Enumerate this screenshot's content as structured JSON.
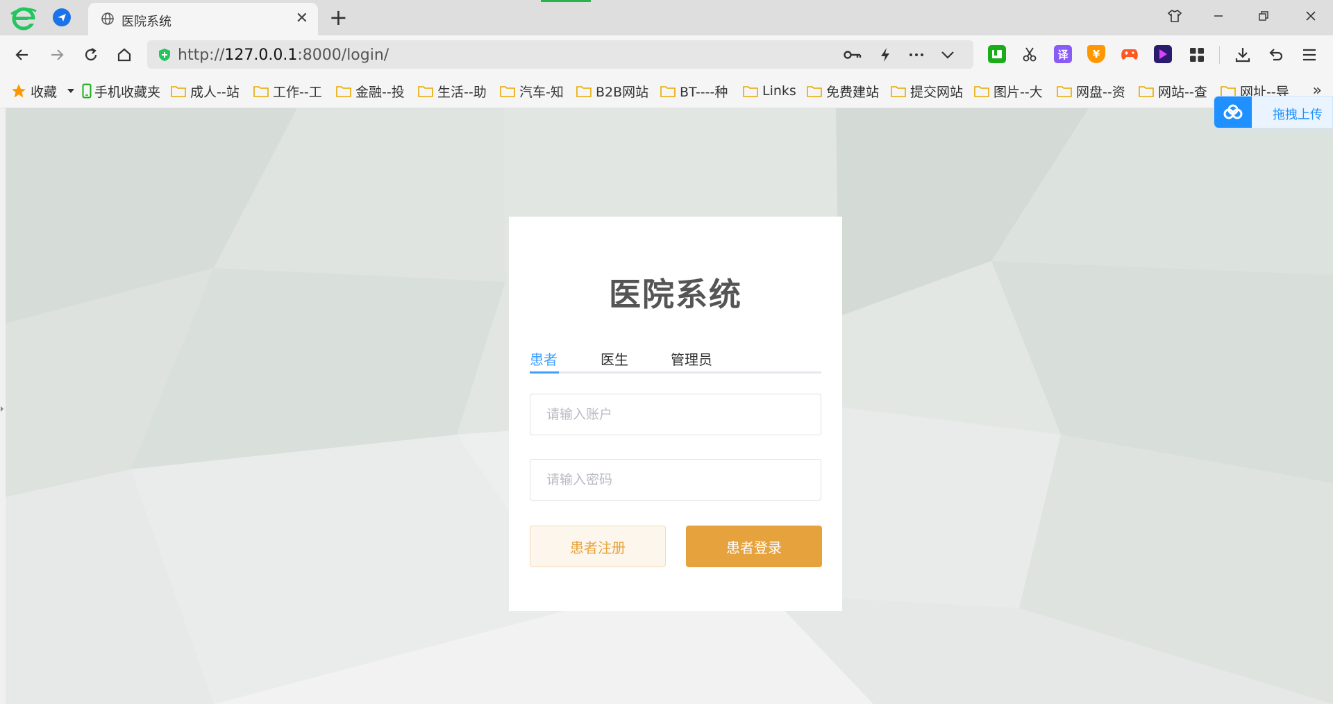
{
  "browser": {
    "tab_title": "医院系统",
    "url_scheme": "http://",
    "url_host": "127.0.0.1",
    "url_rest": ":8000/login/",
    "extensions": [
      {
        "name": "book",
        "glyph": "▮",
        "color": "#1aad19"
      },
      {
        "name": "scissors",
        "glyph": "✂",
        "color": ""
      },
      {
        "name": "translate",
        "glyph": "译",
        "color": "#8a5cf6"
      },
      {
        "name": "coin",
        "glyph": "¥",
        "color": "#ff9800"
      },
      {
        "name": "game",
        "glyph": "",
        "color": "#ff5722"
      },
      {
        "name": "player",
        "glyph": "▶",
        "color": "#2a1b6e"
      }
    ]
  },
  "bookmarks": {
    "favorites_label": "收藏",
    "items": [
      {
        "label": "手机收藏夹",
        "type": "phone"
      },
      {
        "label": "成人--站",
        "type": "folder"
      },
      {
        "label": "工作--工",
        "type": "folder"
      },
      {
        "label": "金融--投",
        "type": "folder"
      },
      {
        "label": "生活--助",
        "type": "folder"
      },
      {
        "label": "汽车-知",
        "type": "folder"
      },
      {
        "label": "B2B网站",
        "type": "folder"
      },
      {
        "label": "BT----种",
        "type": "folder"
      },
      {
        "label": "Links",
        "type": "folder"
      },
      {
        "label": "免费建站",
        "type": "folder"
      },
      {
        "label": "提交网站",
        "type": "folder"
      },
      {
        "label": "图片--大",
        "type": "folder"
      },
      {
        "label": "网盘--资",
        "type": "folder"
      },
      {
        "label": "网站--查",
        "type": "folder"
      },
      {
        "label": "网址--导",
        "type": "folder"
      }
    ],
    "overflow_label": "»"
  },
  "upload": {
    "label": "拖拽上传"
  },
  "login": {
    "title": "医院系统",
    "tabs": [
      {
        "label": "患者",
        "active": true
      },
      {
        "label": "医生",
        "active": false
      },
      {
        "label": "管理员",
        "active": false
      }
    ],
    "account_placeholder": "请输入账户",
    "password_placeholder": "请输入密码",
    "register_label": "患者注册",
    "login_label": "患者登录"
  },
  "colors": {
    "accent_blue": "#409eff",
    "warning_orange": "#e6a23c",
    "warning_light": "#fdf6ec"
  }
}
